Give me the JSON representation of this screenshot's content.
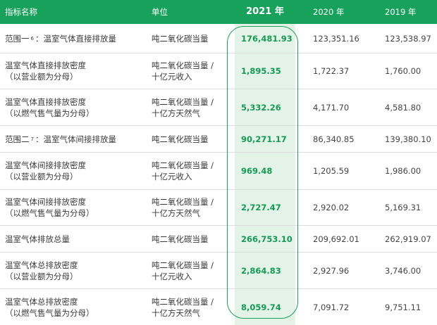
{
  "header": {
    "col_name": "指标名称",
    "col_unit": "单位",
    "col_2021": "2021 年",
    "col_2020": "2020 年",
    "col_2019": "2019 年"
  },
  "rows": [
    {
      "name": "范围一",
      "footnote": "6",
      "name_suffix": "：温室气体直接排放量",
      "unit": "吨二氧化碳当量",
      "v2021": "176,481.93",
      "v2020": "123,351.16",
      "v2019": "123,538.97"
    },
    {
      "name": "温室气体直接排放密度\n（以营业额为分母）",
      "unit": "吨二氧化碳当量 /\n十亿元收入",
      "v2021": "1,895.35",
      "v2020": "1,722.37",
      "v2019": "1,760.00"
    },
    {
      "name": "温室气体直接排放密度\n（以燃气售气量为分母）",
      "unit": "吨二氧化碳当量 /\n十亿方天然气",
      "v2021": "5,332.26",
      "v2020": "4,171.70",
      "v2019": "4,581.80"
    },
    {
      "name": "范围二",
      "footnote": "7",
      "name_suffix": "：温室气体间接排放量",
      "unit": "吨二氧化碳当量",
      "v2021": "90,271.17",
      "v2020": "86,340.85",
      "v2019": "139,380.10"
    },
    {
      "name": "温室气体间接排放密度\n（以营业额为分母）",
      "unit": "吨二氧化碳当量 /\n十亿元收入",
      "v2021": "969.48",
      "v2020": "1,205.59",
      "v2019": "1,986.00"
    },
    {
      "name": "温室气体间接排放密度\n（以燃气售气量为分母）",
      "unit": "吨二氧化碳当量 /\n十亿方天然气",
      "v2021": "2,727.47",
      "v2020": "2,920.02",
      "v2019": "5,169.31"
    },
    {
      "name": "温室气体排放总量",
      "unit": "吨二氧化碳当量",
      "v2021": "266,753.10",
      "v2020": "209,692.01",
      "v2019": "262,919.07"
    },
    {
      "name": "温室气体总排放密度\n（以营业额为分母）",
      "unit": "吨二氧化碳当量 /\n十亿元收入",
      "v2021": "2,864.83",
      "v2020": "2,927.96",
      "v2019": "3,746.00"
    },
    {
      "name": "温室气体总排放密度\n（以燃气售气量为分母）",
      "unit": "吨二氧化碳当量 /\n十亿方天然气",
      "v2021": "8,059.74",
      "v2020": "7,091.72",
      "v2019": "9,751.11"
    }
  ]
}
